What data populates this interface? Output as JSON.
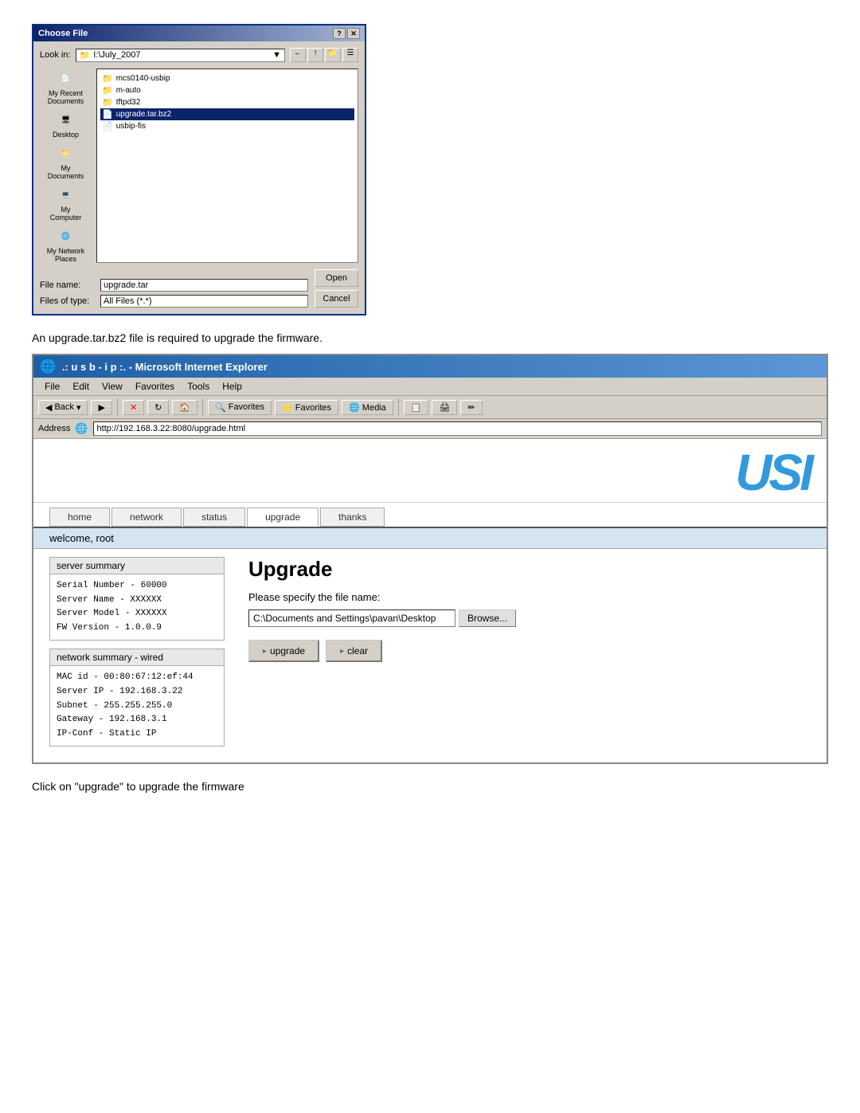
{
  "file_dialog": {
    "title": "Choose File",
    "lookin_label": "Look in:",
    "lookin_value": "I:\\July_2007",
    "files": [
      {
        "name": "mcs0140-usbip",
        "type": "folder",
        "selected": false
      },
      {
        "name": "m-auto",
        "type": "folder",
        "selected": false
      },
      {
        "name": "tftpd32",
        "type": "folder",
        "selected": false
      },
      {
        "name": "upgrade.tar.bz2",
        "type": "file",
        "selected": true
      },
      {
        "name": "usbip-fis",
        "type": "file",
        "selected": false
      }
    ],
    "filename_label": "File name:",
    "filename_value": "upgrade.tar",
    "filetype_label": "Files of type:",
    "filetype_value": "All Files (*.*)",
    "open_btn": "Open",
    "cancel_btn": "Cancel",
    "sidebar": [
      {
        "label": "My Recent\nDocuments",
        "icon": "📄"
      },
      {
        "label": "Desktop",
        "icon": "🖥"
      },
      {
        "label": "My Documents",
        "icon": "📁"
      },
      {
        "label": "My Computer",
        "icon": "💻"
      },
      {
        "label": "My Network\nPlaces",
        "icon": "🌐"
      }
    ]
  },
  "instruction1": "An upgrade.tar.bz2 file is required to upgrade the firmware.",
  "ie_browser": {
    "title": ".: u s b - i p :. - Microsoft Internet Explorer",
    "menu_items": [
      "File",
      "Edit",
      "View",
      "Favorites",
      "Tools",
      "Help"
    ],
    "toolbar_buttons": [
      "Back",
      "Forward",
      "Stop",
      "Refresh",
      "Home",
      "Search",
      "Favorites",
      "Media"
    ],
    "address_label": "Address",
    "address_url": "http://192.168.3.22:8080/upgrade.html"
  },
  "usi_app": {
    "logo": "USI",
    "nav_items": [
      {
        "label": "home",
        "active": false
      },
      {
        "label": "network",
        "active": false
      },
      {
        "label": "status",
        "active": false
      },
      {
        "label": "upgrade",
        "active": true
      },
      {
        "label": "thanks",
        "active": false
      }
    ],
    "welcome_text": "welcome, root",
    "server_summary": {
      "title": "server summary",
      "lines": [
        "Serial Number - 60000",
        "Server Name  - XXXXXX",
        "Server Model - XXXXXX",
        "FW Version   - 1.0.0.9"
      ]
    },
    "network_summary": {
      "title": "network summary - wired",
      "lines": [
        "MAC id   - 00:80:67:12:ef:44",
        "Server IP - 192.168.3.22",
        "Subnet   - 255.255.255.0",
        "Gateway  - 192.168.3.1",
        "IP-Conf  - Static IP"
      ]
    },
    "upgrade_section": {
      "title": "Upgrade",
      "file_label": "Please specify the file name:",
      "file_path": "C:\\Documents and Settings\\pavan\\Desktop",
      "browse_btn": "Browse...",
      "upgrade_btn": "upgrade",
      "clear_btn": "clear"
    }
  },
  "instruction2": "Click on \"upgrade\" to upgrade the firmware"
}
